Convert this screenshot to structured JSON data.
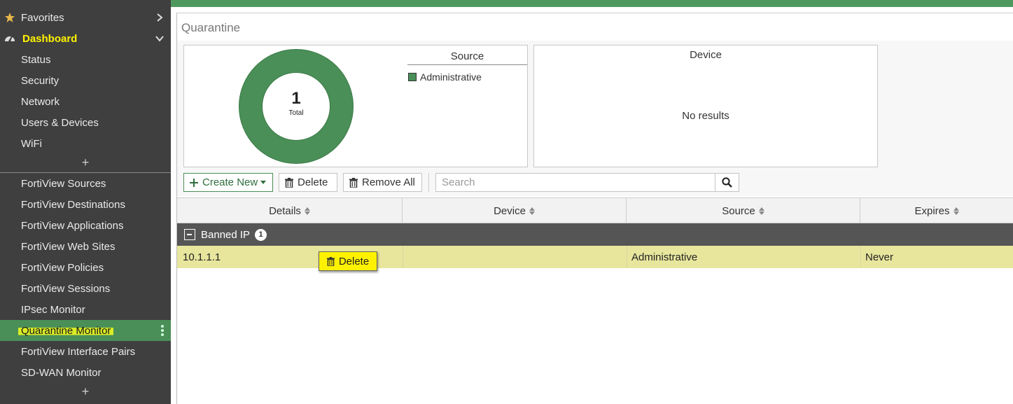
{
  "sidebar": {
    "favorites": {
      "label": "Favorites"
    },
    "dashboard": {
      "label": "Dashboard",
      "items": [
        {
          "label": "Status"
        },
        {
          "label": "Security"
        },
        {
          "label": "Network"
        },
        {
          "label": "Users & Devices"
        },
        {
          "label": "WiFi"
        }
      ]
    },
    "add_symbol": "+",
    "monitors": [
      {
        "label": "FortiView Sources"
      },
      {
        "label": "FortiView Destinations"
      },
      {
        "label": "FortiView Applications"
      },
      {
        "label": "FortiView Web Sites"
      },
      {
        "label": "FortiView Policies"
      },
      {
        "label": "FortiView Sessions"
      },
      {
        "label": "IPsec Monitor"
      },
      {
        "label": "Quarantine Monitor",
        "active": true
      },
      {
        "label": "FortiView Interface Pairs"
      },
      {
        "label": "SD-WAN Monitor"
      }
    ]
  },
  "page": {
    "title": "Quarantine",
    "source_widget": {
      "total_value": "1",
      "total_label": "Total",
      "legend_title": "Source",
      "legend_items": [
        {
          "label": "Administrative",
          "color": "#4a8f57"
        }
      ]
    },
    "device_widget": {
      "title": "Device",
      "empty_text": "No results"
    },
    "toolbar": {
      "create_new": "Create New",
      "delete": "Delete",
      "remove_all": "Remove All",
      "search_placeholder": "Search"
    },
    "table": {
      "columns": [
        "Details",
        "Device",
        "Source",
        "Expires"
      ],
      "group": {
        "label": "Banned IP",
        "count": "1"
      },
      "rows": [
        {
          "details": "10.1.1.1",
          "device": "",
          "source": "Administrative",
          "expires": "Never"
        }
      ]
    },
    "context_action": {
      "label": "Delete"
    }
  },
  "colors": {
    "accent_green": "#4a8f57",
    "highlight_yellow": "#fff200",
    "row_selected": "#e8e69d",
    "sidebar_bg": "#3f3f3f"
  },
  "chart_data": {
    "type": "pie",
    "categories": [
      "Administrative"
    ],
    "values": [
      1
    ],
    "title": "Source"
  }
}
